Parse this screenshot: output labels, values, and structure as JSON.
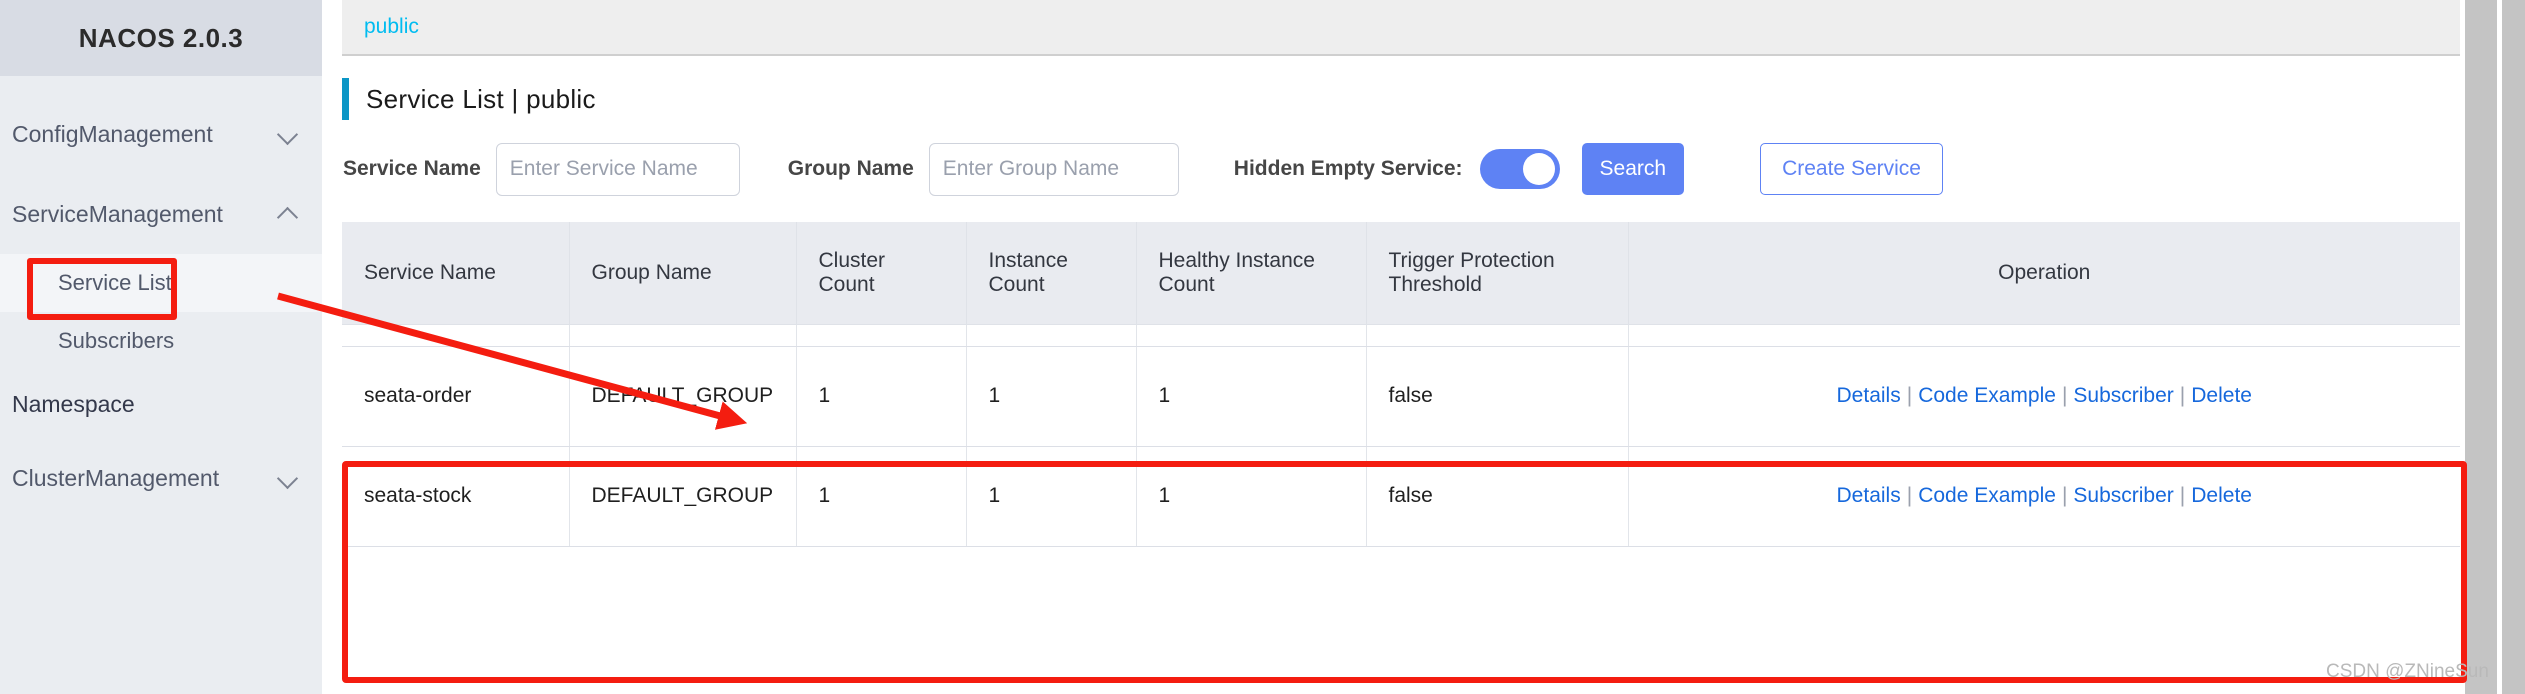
{
  "sidebar": {
    "logo": "NACOS 2.0.3",
    "items": [
      {
        "label": "ConfigManagement",
        "type": "group",
        "expanded": false,
        "chevron": "chevron-down-icon"
      },
      {
        "label": "ServiceManagement",
        "type": "group",
        "expanded": true,
        "chevron": "chevron-up-icon"
      },
      {
        "label": "Service List",
        "type": "sub",
        "selected": true
      },
      {
        "label": "Subscribers",
        "type": "sub",
        "selected": false
      },
      {
        "label": "Namespace",
        "type": "plain"
      },
      {
        "label": "ClusterManagement",
        "type": "group",
        "expanded": false,
        "chevron": "chevron-down-icon"
      }
    ]
  },
  "breadcrumb": {
    "current": "public"
  },
  "page": {
    "title": "Service List  |  public",
    "accent_color": "#0b96c6"
  },
  "filters": {
    "service_name_label": "Service Name",
    "service_name_placeholder": "Enter Service Name",
    "service_name_value": "",
    "group_name_label": "Group Name",
    "group_name_placeholder": "Enter Group Name",
    "group_name_value": "",
    "hidden_empty_service_label": "Hidden Empty Service:",
    "hidden_empty_service_on": true,
    "search_button": "Search",
    "create_service_button": "Create Service",
    "primary_color": "#5e82f4"
  },
  "table": {
    "columns": [
      "Service Name",
      "Group Name",
      "Cluster Count",
      "Instance Count",
      "Healthy Instance Count",
      "Trigger Protection Threshold",
      "Operation"
    ],
    "operation_links": [
      "Details",
      "Code Example",
      "Subscriber",
      "Delete"
    ],
    "rows": [
      {
        "service_name": "seata-order",
        "group_name": "DEFAULT_GROUP",
        "cluster_count": "1",
        "instance_count": "1",
        "healthy_instance_count": "1",
        "trigger_protection_threshold": "false"
      },
      {
        "service_name": "seata-stock",
        "group_name": "DEFAULT_GROUP",
        "cluster_count": "1",
        "instance_count": "1",
        "healthy_instance_count": "1",
        "trigger_protection_threshold": "false"
      }
    ]
  },
  "annotations": {
    "highlight_color": "#f41d10",
    "boxes": [
      "sidebar-service-list",
      "table-rows"
    ],
    "arrow": "sidebar-to-table-arrow"
  },
  "watermark": "CSDN @ZNineSun"
}
